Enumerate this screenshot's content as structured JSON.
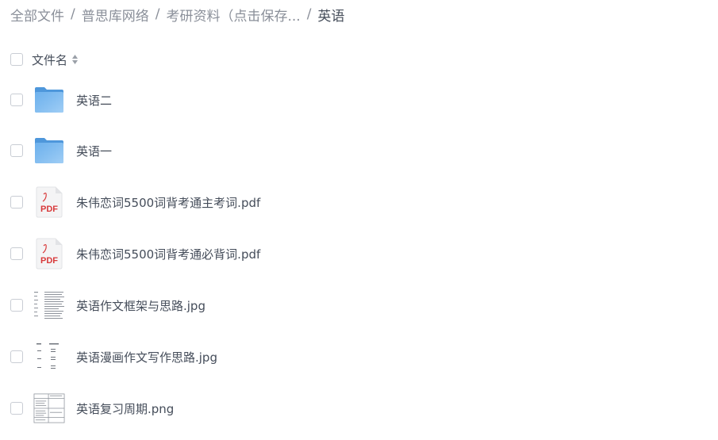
{
  "breadcrumb": {
    "items": [
      {
        "label": "全部文件"
      },
      {
        "label": "普思库网络"
      },
      {
        "label": "考研资料（点击保存..."
      },
      {
        "label": "英语"
      }
    ],
    "separator": "/"
  },
  "list_header": {
    "name_column": "文件名"
  },
  "files": [
    {
      "name": "英语二",
      "type": "folder"
    },
    {
      "name": "英语一",
      "type": "folder"
    },
    {
      "name": "朱伟恋词5500词背考通主考词.pdf",
      "type": "pdf",
      "icon_text": "PDF"
    },
    {
      "name": "朱伟恋词5500词背考通必背词.pdf",
      "type": "pdf",
      "icon_text": "PDF"
    },
    {
      "name": "英语作文框架与思路.jpg",
      "type": "image"
    },
    {
      "name": "英语漫画作文写作思路.jpg",
      "type": "image"
    },
    {
      "name": "英语复习周期.png",
      "type": "image"
    }
  ],
  "colors": {
    "text_primary": "#454d5a",
    "text_muted": "#8a8f99",
    "folder_blue": "#5aa4e8",
    "pdf_red": "#d8393a",
    "checkbox_border": "#c9cdd4"
  }
}
